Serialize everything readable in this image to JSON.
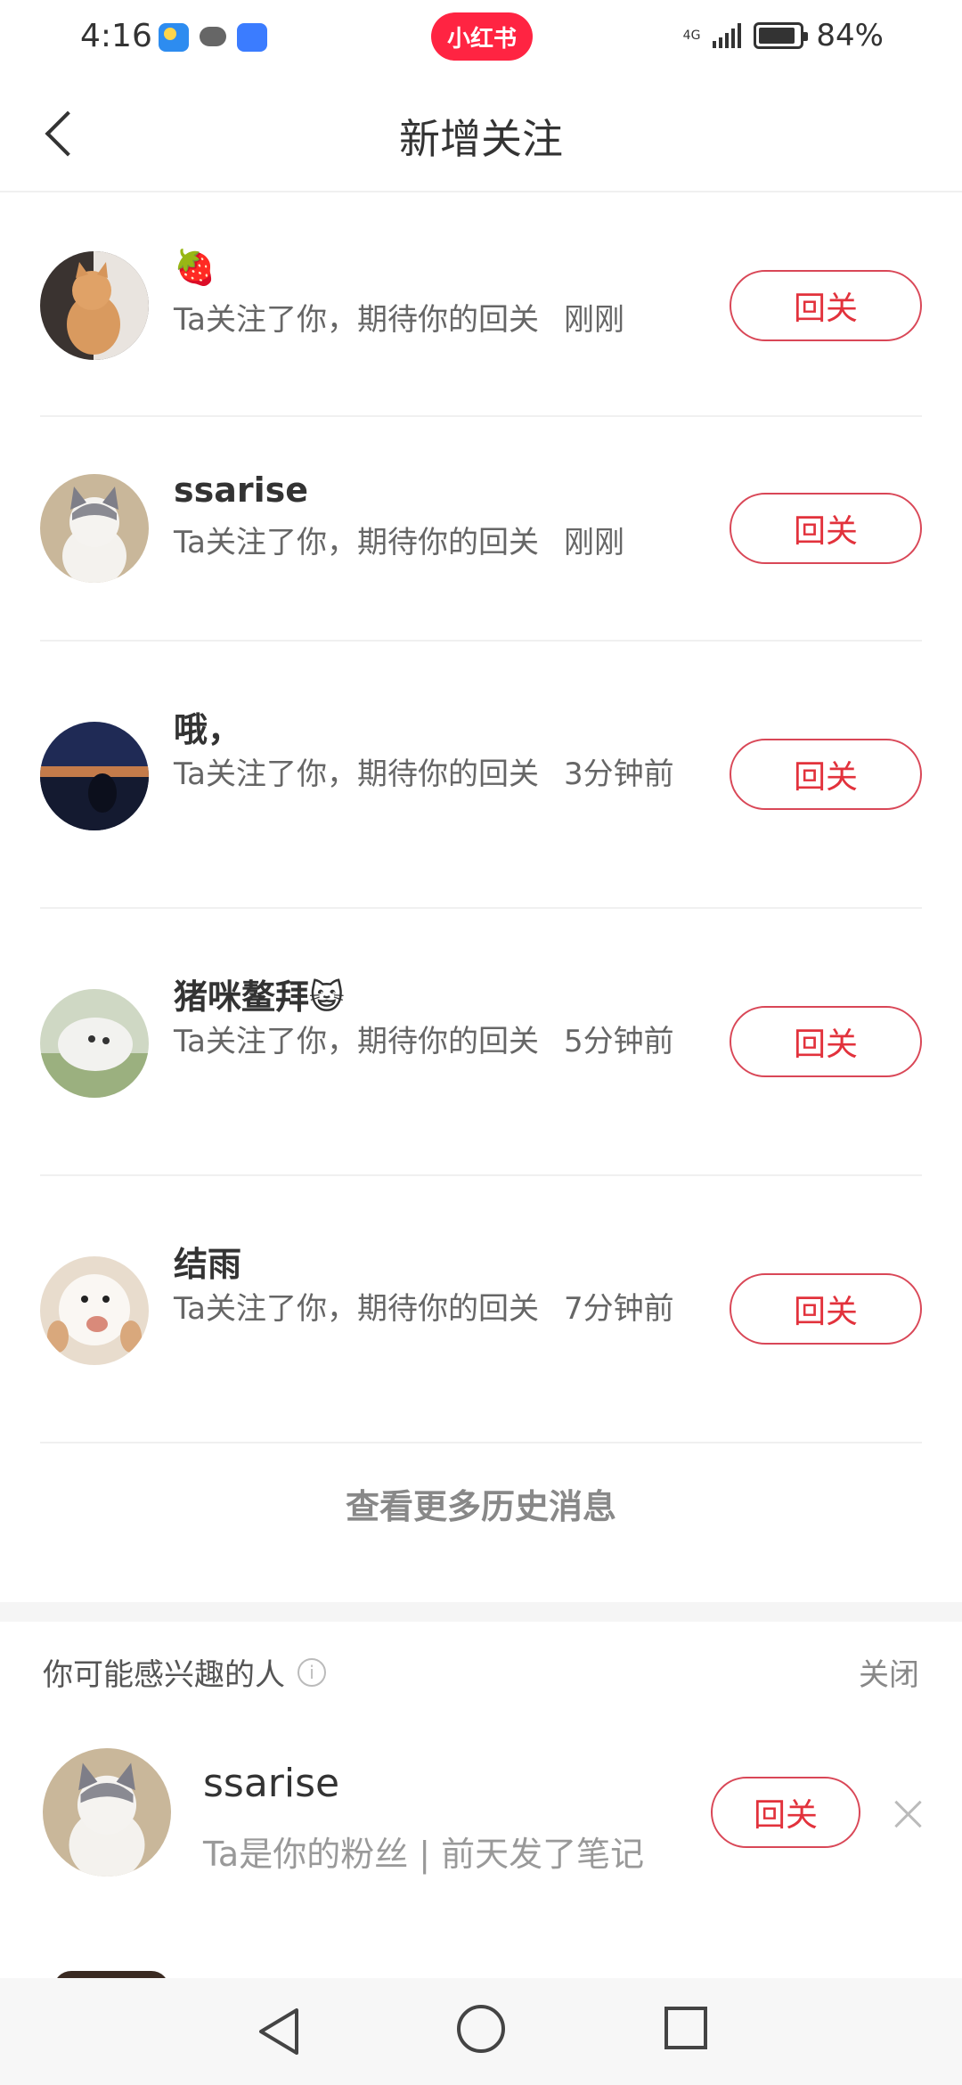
{
  "status_bar": {
    "time": "4:16",
    "app_badge": "小红书",
    "network": "4G",
    "battery_percent": "84%"
  },
  "header": {
    "title": "新增关注"
  },
  "followers": [
    {
      "name": "🍓",
      "desc": "Ta关注了你，期待你的回关",
      "time": "刚刚",
      "button": "回关"
    },
    {
      "name": "ssarise",
      "desc": "Ta关注了你，期待你的回关",
      "time": "刚刚",
      "button": "回关"
    },
    {
      "name": "哦，",
      "desc": "Ta关注了你，期待你的回关",
      "time": "3分钟前",
      "button": "回关"
    },
    {
      "name": "猪咪鳌拜😺",
      "desc": "Ta关注了你，期待你的回关",
      "time": "5分钟前",
      "button": "回关"
    },
    {
      "name": "结雨",
      "desc": "Ta关注了你，期待你的回关",
      "time": "7分钟前",
      "button": "回关"
    }
  ],
  "view_more": "查看更多历史消息",
  "suggestions": {
    "title": "你可能感兴趣的人",
    "info_glyph": "i",
    "close": "关闭",
    "items": [
      {
        "name": "ssarise",
        "desc": "Ta是你的粉丝 | 前天发了笔记",
        "button": "回关"
      }
    ]
  },
  "colors": {
    "brand": "#ff2442",
    "button_text": "#e2323c",
    "button_border": "#d94757"
  }
}
